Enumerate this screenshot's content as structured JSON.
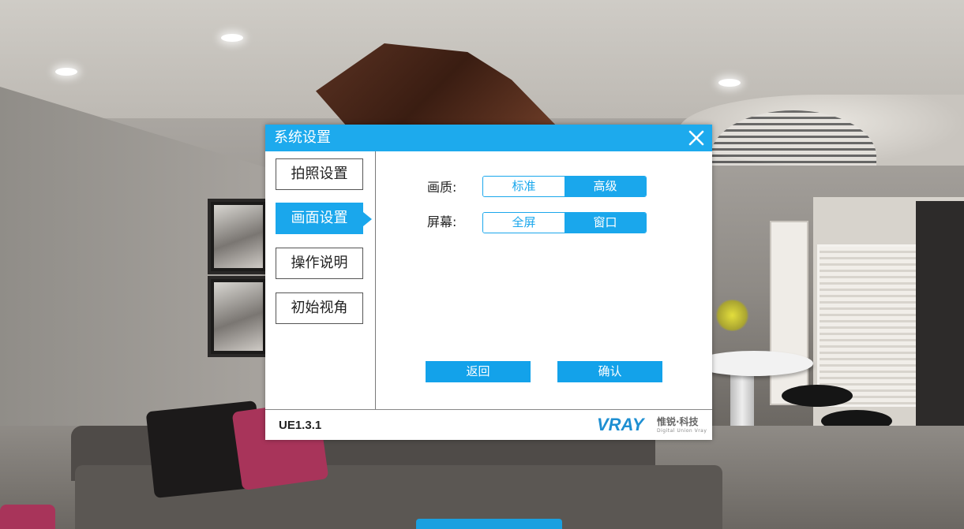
{
  "dialog": {
    "title": "系统设置",
    "close_icon": "close-icon"
  },
  "sidebar": {
    "items": [
      {
        "label": "拍照设置",
        "active": false
      },
      {
        "label": "画面设置",
        "active": true
      },
      {
        "label": "操作说明",
        "active": false
      },
      {
        "label": "初始视角",
        "active": false
      }
    ]
  },
  "settings": {
    "quality": {
      "label": "画质:",
      "options": [
        "标准",
        "高级"
      ],
      "selected": "高级"
    },
    "screen": {
      "label": "屏幕:",
      "options": [
        "全屏",
        "窗口"
      ],
      "selected": "窗口"
    }
  },
  "actions": {
    "back_label": "返回",
    "confirm_label": "确认"
  },
  "footer": {
    "version": "UE1.3.1",
    "logo_word": "VRAY",
    "logo_cn": "惟锐·科技",
    "logo_en": "Digital Union Vray"
  },
  "colors": {
    "accent": "#1daaed"
  }
}
